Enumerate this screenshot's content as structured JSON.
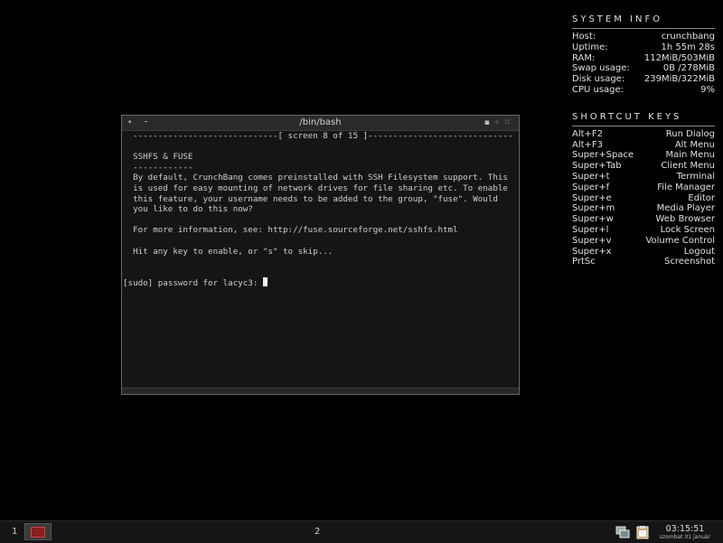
{
  "conky": {
    "system_title": "SYSTEM INFO",
    "system": [
      {
        "label": "Host:",
        "value": "crunchbang"
      },
      {
        "label": "Uptime:",
        "value": "1h 55m 28s"
      },
      {
        "label": "RAM:",
        "value": "112MiB/503MiB"
      },
      {
        "label": "Swap usage:",
        "value": "0B  /278MiB"
      },
      {
        "label": "Disk usage:",
        "value": "239MiB/322MiB"
      },
      {
        "label": "CPU usage:",
        "value": "9%"
      }
    ],
    "shortcut_title": "SHORTCUT KEYS",
    "shortcuts": [
      {
        "key": "Alt+F2",
        "action": "Run Dialog"
      },
      {
        "key": "Alt+F3",
        "action": "Alt Menu"
      },
      {
        "key": "Super+Space",
        "action": "Main Menu"
      },
      {
        "key": "Super+Tab",
        "action": "Client Menu"
      },
      {
        "key": "Super+t",
        "action": "Terminal"
      },
      {
        "key": "Super+f",
        "action": "File Manager"
      },
      {
        "key": "Super+e",
        "action": "Editor"
      },
      {
        "key": "Super+m",
        "action": "Media Player"
      },
      {
        "key": "Super+w",
        "action": "Web Browser"
      },
      {
        "key": "Super+l",
        "action": "Lock Screen"
      },
      {
        "key": "Super+v",
        "action": "Volume Control"
      },
      {
        "key": "Super+x",
        "action": "Logout"
      },
      {
        "key": "PrtSc",
        "action": "Screenshot"
      }
    ]
  },
  "terminal": {
    "title": "/bin/bash",
    "lines": [
      "  -----------------------------[ screen 8 of 15 ]-----------------------------",
      "",
      "  SSHFS & FUSE",
      "  ------------",
      "  By default, CrunchBang comes preinstalled with SSH Filesystem support. This",
      "  is used for easy mounting of network drives for file sharing etc. To enable",
      "  this feature, your username needs to be added to the group, \"fuse\". Would",
      "  you like to do this now?",
      "",
      "  For more information, see: http://fuse.sourceforge.net/sshfs.html",
      "",
      "  Hit any key to enable, or \"s\" to skip...",
      "",
      ""
    ],
    "prompt": "[sudo] password for lacyc3: "
  },
  "logo": "#!",
  "taskbar": {
    "workspace1": "1",
    "workspace2": "2",
    "clock_time": "03:15:51",
    "clock_date": "szombat 01 január"
  }
}
